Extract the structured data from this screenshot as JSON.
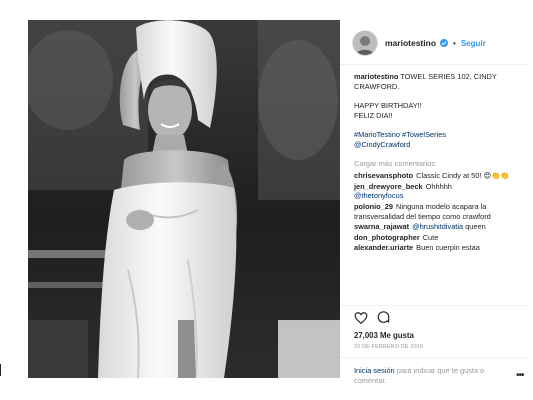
{
  "header": {
    "username": "mariotestino",
    "separator": "•",
    "follow_label": "Seguir"
  },
  "caption": {
    "username": "mariotestino",
    "line1": "TOWEL SERIES 102, CINDY CRAWFORD.",
    "line2": "HAPPY BIRTHDAY!!",
    "line3": "FELIZ DIA!!",
    "hashtags": "#MarioTestino #TowelSeries",
    "mention": "@CindyCrawford"
  },
  "load_more_label": "Cargar más comentarios",
  "comments": [
    {
      "user": "chrisevansphoto",
      "text": "Classic Cindy at 50! 😍👏👏",
      "mention": ""
    },
    {
      "user": "jen_drewyore_beck",
      "text": "Ohhhhh",
      "mention": "@thetonyfocus"
    },
    {
      "user": "polonio_29",
      "text": "Ninguna modelo acapara la transversalidad del tiempo como crawford",
      "mention": ""
    },
    {
      "user": "swarna_rajawat",
      "text": "queen",
      "mention": "@hrushitdivatia"
    },
    {
      "user": "don_photographer",
      "text": "Cute",
      "mention": ""
    },
    {
      "user": "alexander.uriarte",
      "text": "Buen cuerpin estaa",
      "mention": ""
    }
  ],
  "actions": {
    "like_icon": "heart-icon",
    "comment_icon": "comment-icon"
  },
  "likes": "27,003 Me gusta",
  "date": "20 DE FEBRERO DE 2016",
  "login": {
    "link": "Inicia sesión",
    "text": " para indicar que te gusta o comentar."
  },
  "more_label": "•••",
  "colors": {
    "link": "#3897f0",
    "tag": "#003569",
    "muted": "#999999",
    "text": "#262626"
  }
}
